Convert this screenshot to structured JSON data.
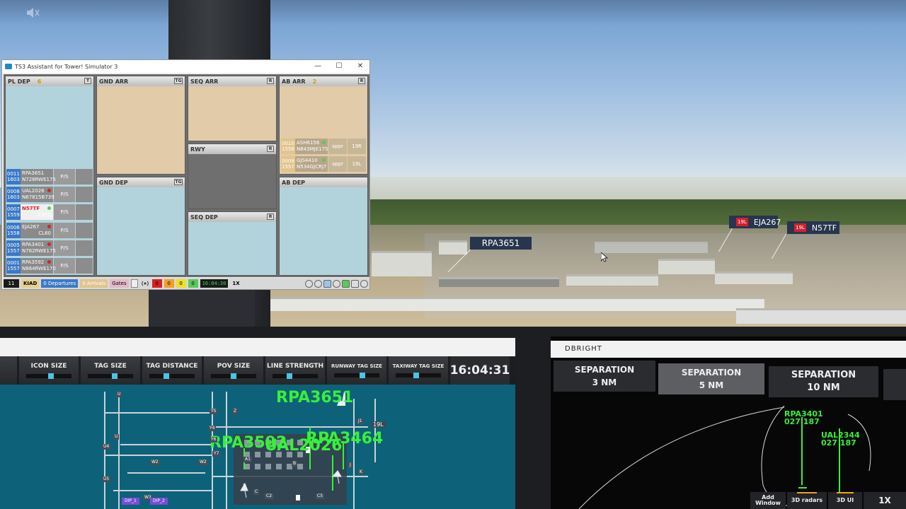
{
  "window": {
    "title": "TS3 Assistant for Tower! Simulator 3",
    "controls": {
      "minimize": "—",
      "maximize": "☐",
      "close": "✕"
    }
  },
  "panes": {
    "pl_dep": {
      "title": "PL DEP",
      "count": "6",
      "btn": "T"
    },
    "gnd_arr": {
      "title": "GND ARR",
      "btn": "TG"
    },
    "seq_arr": {
      "title": "SEQ ARR",
      "btn": "R"
    },
    "ab_arr": {
      "title": "AB ARR",
      "count": "2",
      "btn": "R"
    },
    "rwy": {
      "title": "RWY",
      "btn": "R"
    },
    "gnd_dep": {
      "title": "GND DEP",
      "btn": "TG"
    },
    "seq_dep": {
      "title": "SEQ DEP",
      "btn": "R"
    },
    "ab_dep": {
      "title": "AB DEP"
    }
  },
  "departure_strips": [
    {
      "sq": "0011",
      "time": "1603",
      "callsign": "RPA3651",
      "reg": "N728RW",
      "type": "E175",
      "ps": "P/S",
      "dot": ""
    },
    {
      "sq": "0008",
      "time": "1603",
      "callsign": "UAL2026",
      "reg": "N67815",
      "type": "B739",
      "ps": "P/S",
      "dot": "#e02020"
    },
    {
      "sq": "0007",
      "time": "1559",
      "callsign": "N57TF",
      "reg": "",
      "type": "C650",
      "ps": "P/S",
      "dot": "#5ac85a",
      "highlight": "#e02020"
    },
    {
      "sq": "0006",
      "time": "1558",
      "callsign": "EJA267",
      "reg": "",
      "type": "CL60",
      "ps": "P/S",
      "dot": "#e02020"
    },
    {
      "sq": "0005",
      "time": "1557",
      "callsign": "RPA3401",
      "reg": "N762RW",
      "type": "E175",
      "ps": "P/S",
      "dot": "#e02020"
    },
    {
      "sq": "0001",
      "time": "1557",
      "callsign": "RPA3592",
      "reg": "N864RW",
      "type": "E170",
      "ps": "P/S",
      "dot": "#e02020"
    }
  ],
  "arrival_strips": [
    {
      "sq": "0010",
      "time": "1558",
      "callsign": "ASH6156",
      "reg": "N843MJ",
      "type": "E175",
      "ap": "appr",
      "rwy": "19R"
    },
    {
      "sq": "0009",
      "time": "1557",
      "callsign": "GJS4410",
      "reg": "N534GJ",
      "type": "CRJ7",
      "ap": "appr",
      "rwy": "19L"
    }
  ],
  "status": {
    "number": "11",
    "airport": "KIAD",
    "departures": "0 Departures",
    "arrivals": "0 Arrivals",
    "gates": "Gates",
    "counts": [
      "0",
      "0",
      "0",
      "0"
    ],
    "clock": "16:04:30",
    "rate": "1X"
  },
  "scene_tags": [
    {
      "callsign": "RPA3651",
      "rw": ""
    },
    {
      "callsign": "EJA267",
      "rw": "19L"
    },
    {
      "callsign": "N57TF",
      "rw": "19L"
    }
  ],
  "ground_radar": {
    "controls": [
      {
        "label": "ICON SIZE",
        "level": 0.55
      },
      {
        "label": "TAG SIZE",
        "level": 0.6
      },
      {
        "label": "TAG DISTANCE",
        "level": 0.35
      },
      {
        "label": "POV SIZE",
        "level": 0.5
      },
      {
        "label": "LINE STRENGTH",
        "level": 0.35
      },
      {
        "label": "RUNWAY TAG SIZE",
        "level": 0.65
      },
      {
        "label": "TAXIWAY TAG SIZE",
        "level": 0.45
      }
    ],
    "clock": "16:04:31",
    "aircraft_labels": [
      "RPA3651",
      "RPA3592",
      "UAL2026",
      "RPA3464"
    ],
    "runway_label": "19L",
    "taxiway_labels": [
      "U",
      "U4",
      "U5",
      "W2",
      "W3",
      "Y5",
      "Y4",
      "Y6",
      "Y7",
      "Z",
      "A1",
      "B",
      "C",
      "C2",
      "C5",
      "J",
      "K",
      "J1",
      "U",
      "W2"
    ],
    "dip_labels": [
      "DIP_1",
      "DIP_2"
    ]
  },
  "air_radar": {
    "title": "DBRIGHT",
    "separations": [
      "SEPARATION\n3 NM",
      "SEPARATION\n5 NM",
      "SEPARATION\n10 NM"
    ],
    "tags": [
      {
        "line1": "RPA3401",
        "line2": "027 187"
      },
      {
        "line1": "UAL2344",
        "line2": "027 187"
      }
    ],
    "bottom_buttons": [
      "Add\nWindow",
      "3D radars",
      "3D UI",
      "1X"
    ]
  },
  "colors": {
    "sky": "#8fb4d6",
    "radar_green": "#38f03a",
    "strip_blue": "#3a78c7",
    "pane_blue": "#b2d3dc",
    "pane_tan": "#e1cba8"
  }
}
